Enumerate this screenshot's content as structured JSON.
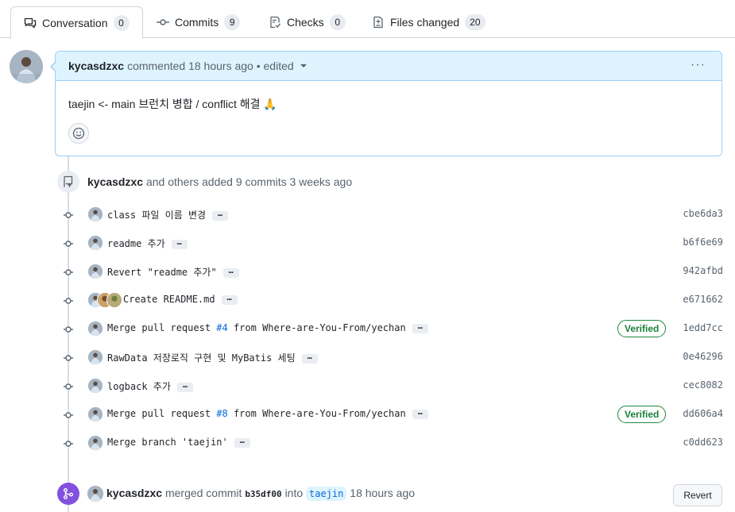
{
  "tabs": [
    {
      "label": "Conversation",
      "count": "0",
      "icon": "comment-discussion-icon"
    },
    {
      "label": "Commits",
      "count": "9",
      "icon": "git-commit-icon"
    },
    {
      "label": "Checks",
      "count": "0",
      "icon": "checklist-icon"
    },
    {
      "label": "Files changed",
      "count": "20",
      "icon": "file-diff-icon"
    }
  ],
  "comment": {
    "author": "kycasdzxc",
    "meta": "commented 18 hours ago • edited",
    "body": "taejin <- main 브런치 병합 / conflict 해결 🙏",
    "menu": "···"
  },
  "commits_event": {
    "author": "kycasdzxc",
    "text": "and others added 9 commits 3 weeks ago"
  },
  "commits": [
    {
      "message": "class 파일 이름 변경",
      "sha": "cbe6da3",
      "verified": false
    },
    {
      "message": "readme 추가",
      "sha": "b6f6e69",
      "verified": false
    },
    {
      "message": "Revert \"readme 추가\"",
      "sha": "942afbd",
      "verified": false
    },
    {
      "message": "Create README.md",
      "sha": "e671662",
      "verified": false
    },
    {
      "message_pre": "Merge pull request ",
      "pr": "#4",
      "message_post": " from Where-are-You-From/yechan",
      "sha": "1edd7cc",
      "verified": true
    },
    {
      "message": "RawData 저장로직 구현 및 MyBatis 세팅",
      "sha": "0e46296",
      "verified": false
    },
    {
      "message": "logback 추가",
      "sha": "cec8082",
      "verified": false
    },
    {
      "message_pre": "Merge pull request ",
      "pr": "#8",
      "message_post": " from Where-are-You-From/yechan",
      "sha": "dd606a4",
      "verified": true
    },
    {
      "message": "Merge branch 'taejin'",
      "sha": "c0dd623",
      "verified": false
    }
  ],
  "verified_label": "Verified",
  "ellipsis_label": "…",
  "merge_event": {
    "author": "kycasdzxc",
    "action": "merged commit",
    "sha": "b35df00",
    "into": "into",
    "branch": "taejin",
    "time": "18 hours ago",
    "revert_label": "Revert"
  },
  "colors": {
    "accent": "#0969da",
    "merged": "#8250df",
    "verified": "#1a7f37",
    "comment_header": "#ddf4ff"
  }
}
